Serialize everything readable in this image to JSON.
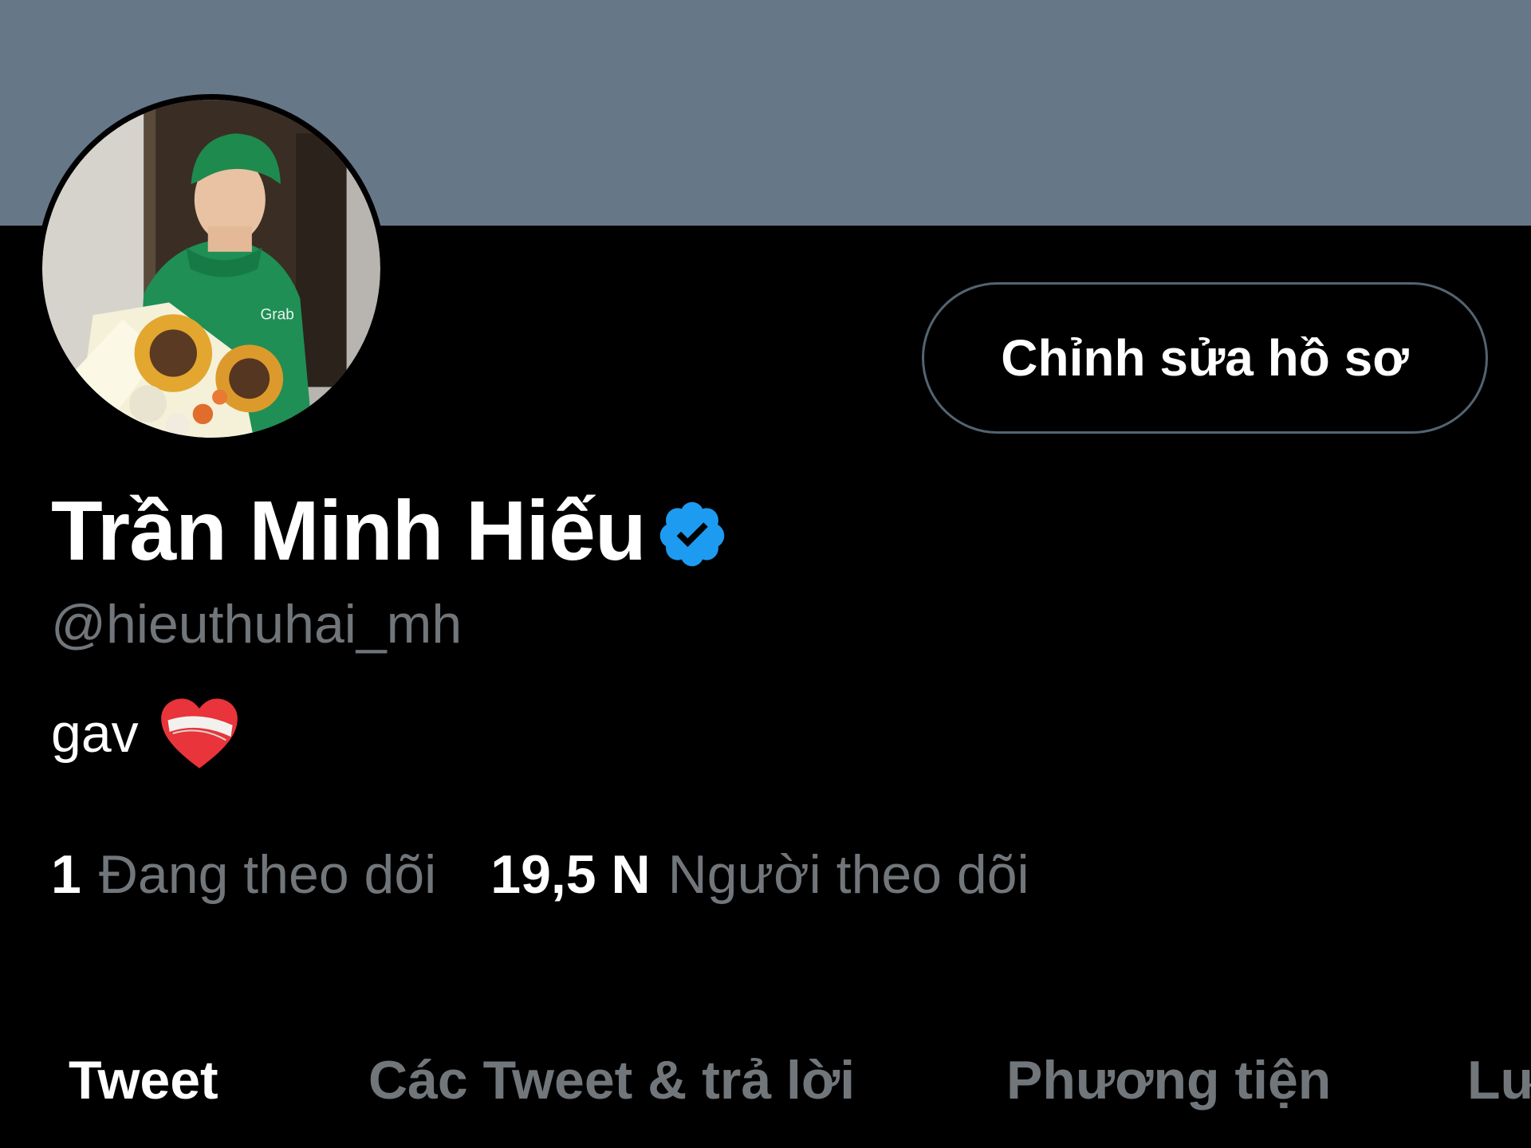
{
  "profile": {
    "display_name": "Trần Minh Hiếu",
    "handle": "@hieuthuhai_mh",
    "bio_text": "gav",
    "bio_emoji": "mending-heart-emoji",
    "verified_icon": "verified-badge-icon",
    "avatar": "profile-photo"
  },
  "actions": {
    "edit_profile_label": "Chỉnh sửa hồ sơ"
  },
  "stats": {
    "following_count": "1",
    "following_label": "Đang theo dõi",
    "followers_count": "19,5 N",
    "followers_label": "Người theo dõi"
  },
  "tabs": [
    {
      "label": "Tweet",
      "active": true
    },
    {
      "label": "Các Tweet & trả lời",
      "active": false
    },
    {
      "label": "Phương tiện",
      "active": false
    },
    {
      "label": "Lư",
      "active": false
    }
  ],
  "colors": {
    "banner": "#667788",
    "background": "#000000",
    "text_primary": "#ffffff",
    "text_secondary": "#71767b",
    "verified": "#1d9bf0",
    "button_border": "#536471"
  }
}
